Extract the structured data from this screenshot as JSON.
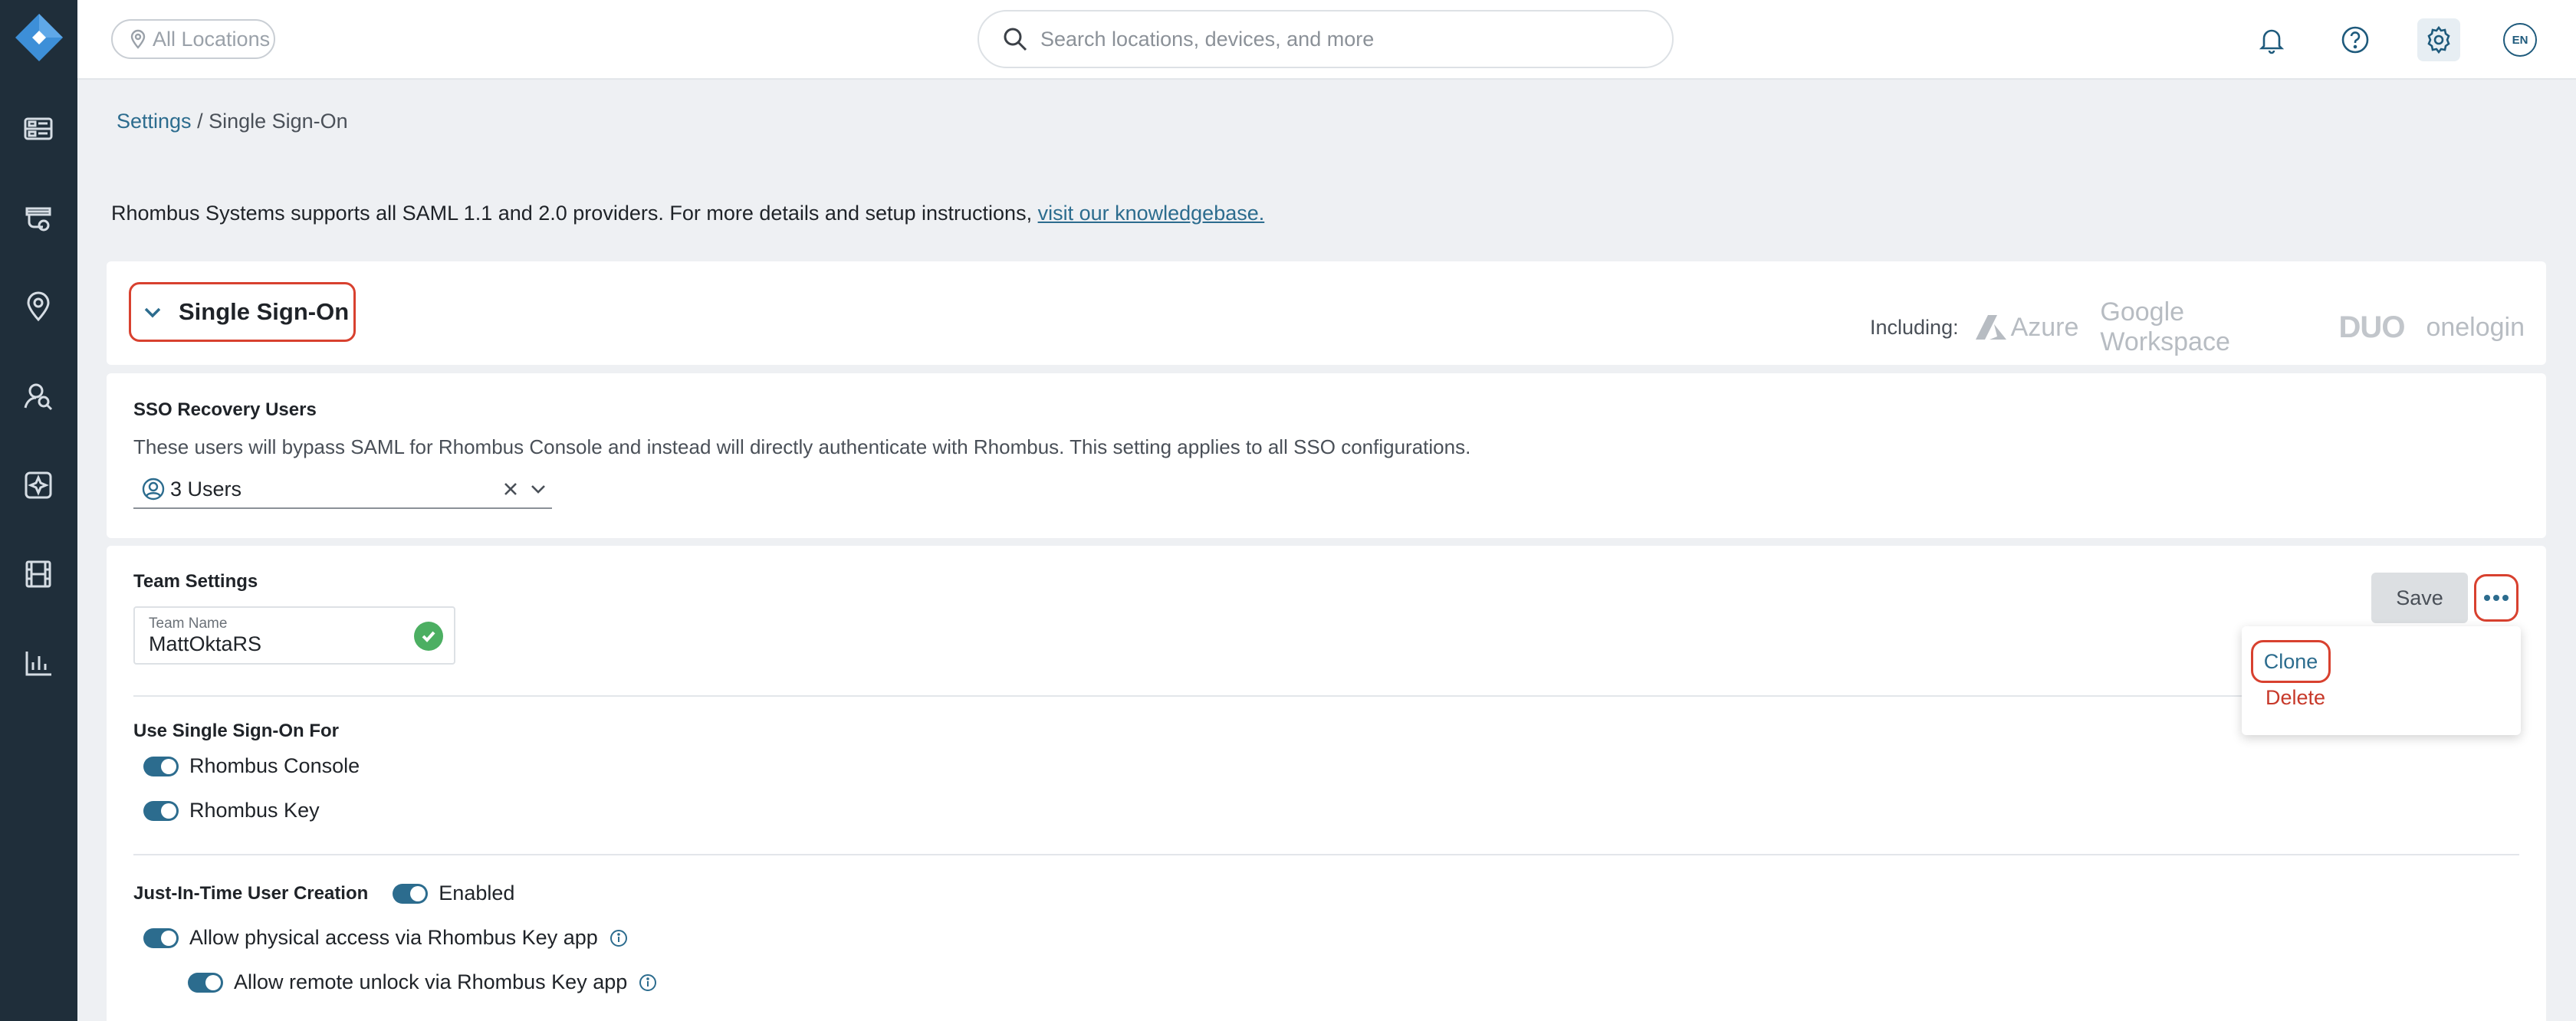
{
  "topbar": {
    "location_filter": "All Locations",
    "search_placeholder": "Search locations, devices, and more",
    "language": "EN"
  },
  "sidebar": {
    "items": [
      "dashboard-icon",
      "cameras-icon",
      "map-pin-icon",
      "search-people-icon",
      "integrations-icon",
      "video-wall-icon",
      "reports-icon"
    ]
  },
  "breadcrumb": {
    "parent": "Settings",
    "separator": " / ",
    "current": "Single Sign-On"
  },
  "info": {
    "text": "Rhombus Systems supports all SAML 1.1 and 2.0 providers. For more details and setup instructions, ",
    "link": "visit our knowledgebase."
  },
  "sso": {
    "title": "Single Sign-On",
    "including_label": "Including:",
    "providers": [
      "Azure",
      "Google Workspace",
      "DUO",
      "onelogin"
    ]
  },
  "recovery": {
    "title": "SSO Recovery Users",
    "description": "These users will bypass SAML for Rhombus Console and instead will directly authenticate with Rhombus. This setting applies to all SSO configurations.",
    "selected": "3 Users"
  },
  "team": {
    "title": "Team Settings",
    "name_label": "Team Name",
    "name_value": "MattOktaRS",
    "save_label": "Save",
    "menu": {
      "clone": "Clone",
      "delete": "Delete"
    },
    "use_sso_title": "Use Single Sign-On For",
    "use_sso": [
      "Rhombus Console",
      "Rhombus Key"
    ],
    "jit_title": "Just-In-Time User Creation",
    "jit_status": "Enabled",
    "physical_access": "Allow physical access via Rhombus Key app",
    "remote_unlock": "Allow remote unlock via Rhombus Key app"
  },
  "colors": {
    "sidebar": "#1f2e3a",
    "accent": "#2c6c8e",
    "highlight": "#d8412f",
    "success": "#4caf62"
  }
}
